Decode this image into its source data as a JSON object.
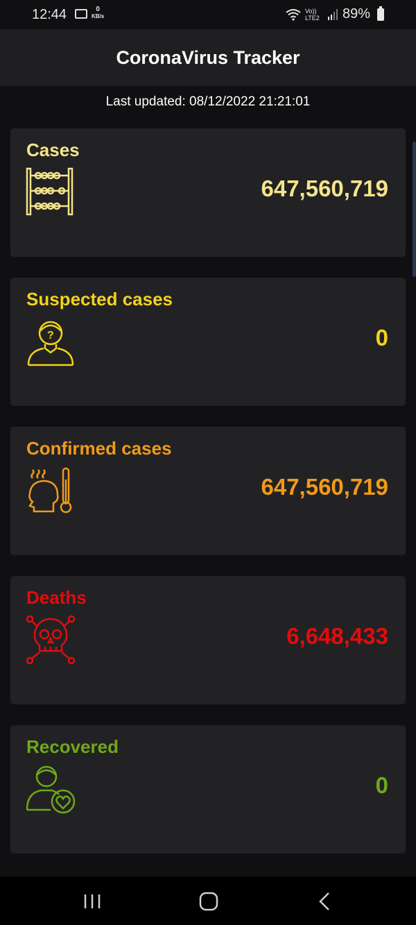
{
  "status": {
    "time": "12:44",
    "kbs_value": "0",
    "kbs_unit": "KB/s",
    "network": "Vo)) LTE2",
    "battery": "89%"
  },
  "app": {
    "title": "CoronaVirus Tracker",
    "last_updated": "Last updated: 08/12/2022 21:21:01"
  },
  "cards": [
    {
      "title": "Cases",
      "value": "647,560,719",
      "color": "#f5e58a",
      "icon": "abacus-icon"
    },
    {
      "title": "Suspected cases",
      "value": "0",
      "color": "#f2d21c",
      "icon": "suspect-person-icon"
    },
    {
      "title": "Confirmed cases",
      "value": "647,560,719",
      "color": "#f09a1a",
      "icon": "fever-thermometer-icon"
    },
    {
      "title": "Deaths",
      "value": "6,648,433",
      "color": "#e00d0d",
      "icon": "skull-crossbones-icon"
    },
    {
      "title": "Recovered",
      "value": "0",
      "color": "#6fa81b",
      "icon": "recovered-person-heart-icon"
    }
  ]
}
